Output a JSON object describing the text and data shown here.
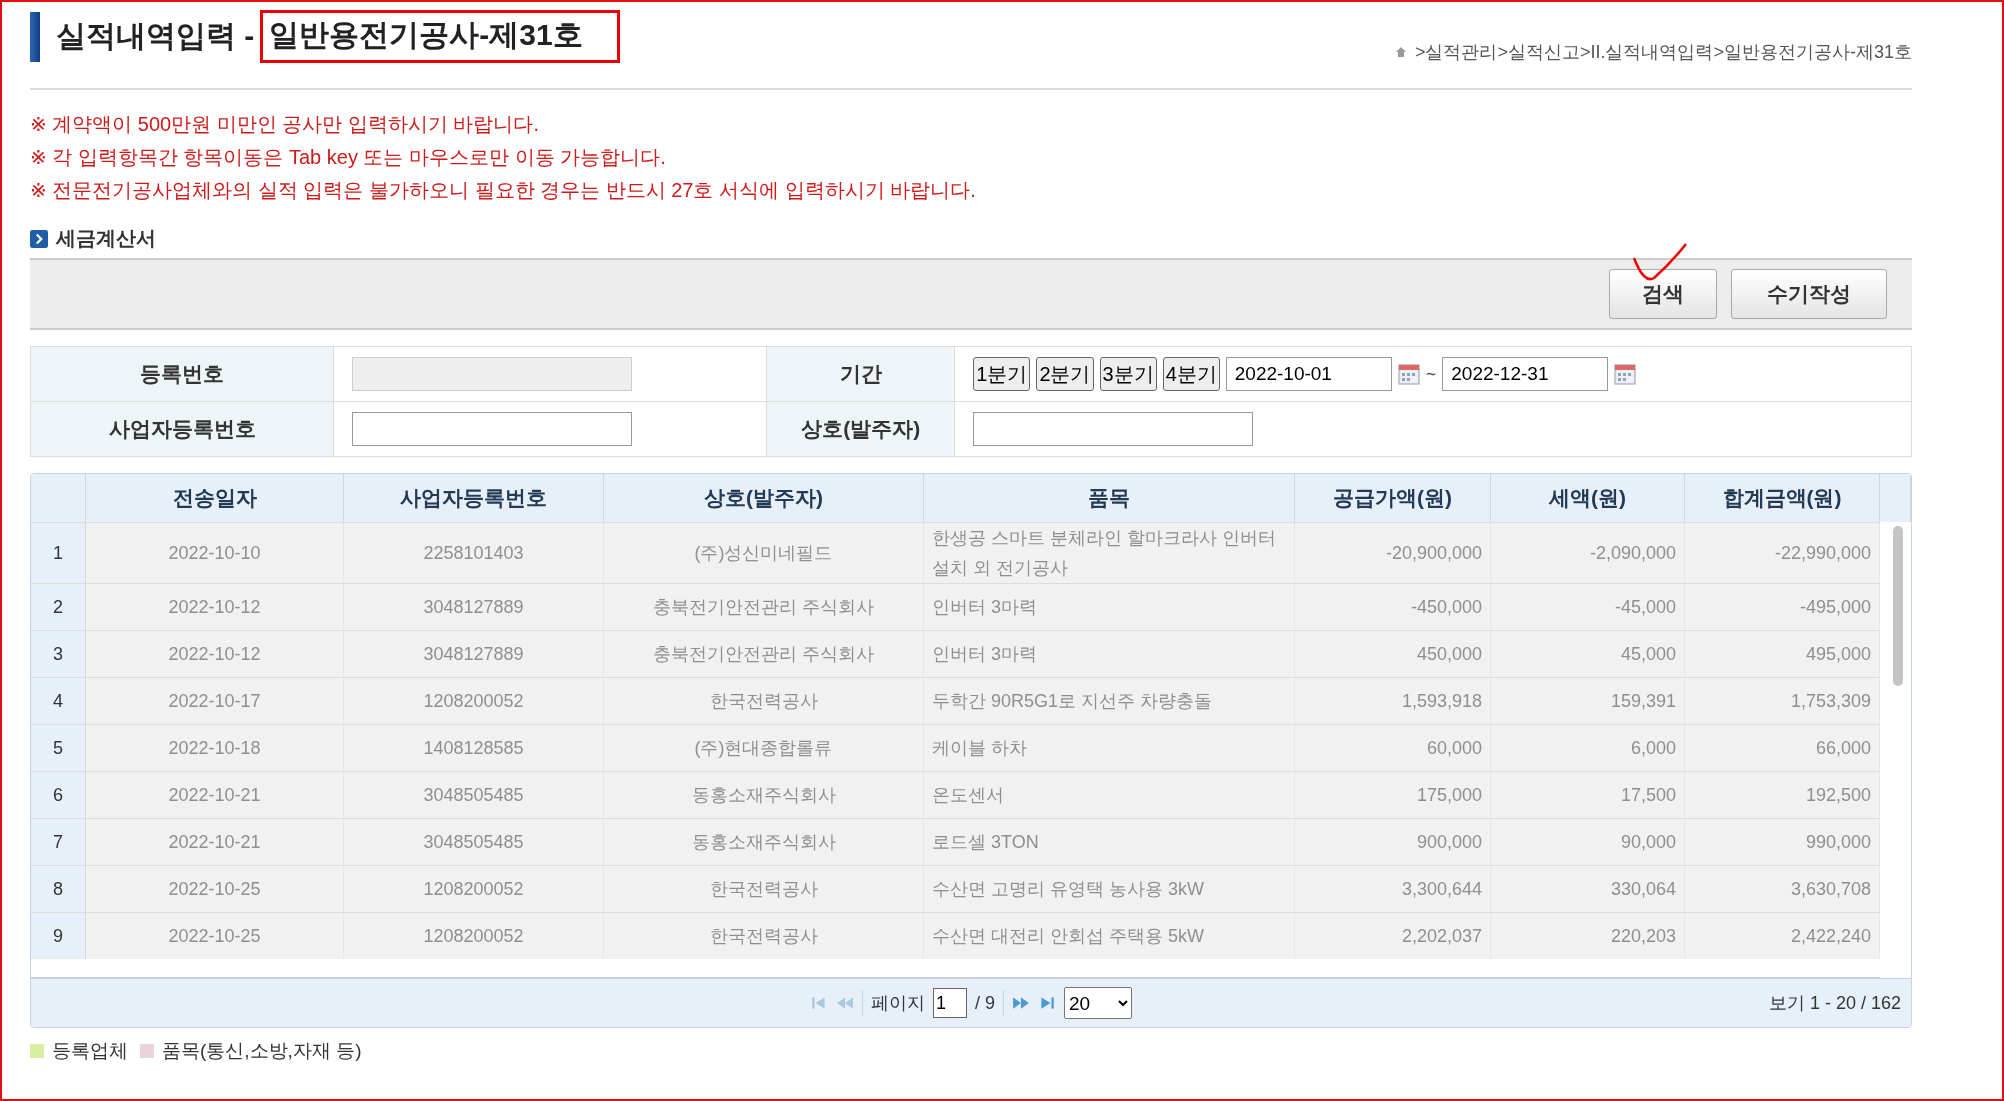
{
  "title": {
    "prefix": "실적내역입력 -",
    "highlight": "일반용전기공사-제31호"
  },
  "breadcrumb": ">실적관리>실적신고>II.실적내역입력>일반용전기공사-제31호",
  "notices": [
    "※ 계약액이 500만원 미만인 공사만 입력하시기 바랍니다.",
    "※ 각 입력항목간 항목이동은 Tab key 또는 마우스로만 이동 가능합니다.",
    "※ 전문전기공사업체와의 실적 입력은 불가하오니 필요한 경우는 반드시 27호 서식에 입력하시기 바랍니다."
  ],
  "section_title": "세금계산서",
  "toolbar_buttons": [
    "검색",
    "수기작성"
  ],
  "search_form": {
    "registration_number": {
      "label": "등록번호",
      "disabled": true
    },
    "business_number": {
      "label": "사업자등록번호",
      "disabled": false
    },
    "period": {
      "label": "기간",
      "quarters": [
        "1분기",
        "2분기",
        "3분기",
        "4분기"
      ],
      "start": "2022-10-01",
      "separator": "~",
      "end": "2022-12-31"
    },
    "company": {
      "label": "상호(발주자)"
    }
  },
  "grid": {
    "columns": [
      "전송일자",
      "사업자등록번호",
      "상호(발주자)",
      "품목",
      "공급가액(원)",
      "세액(원)",
      "합계금액(원)"
    ],
    "rows": [
      {
        "number": "1",
        "cells": [
          "2022-10-10",
          "2258101403",
          "(주)성신미네필드",
          "한생공 스마트 분체라인 할마크라사 인버터 설치 외 전기공사",
          "-20,900,000",
          "-2,090,000",
          "-22,990,000"
        ]
      },
      {
        "number": "2",
        "cells": [
          "2022-10-12",
          "3048127889",
          "충북전기안전관리 주식회사",
          "인버터 3마력",
          "-450,000",
          "-45,000",
          "-495,000"
        ]
      },
      {
        "number": "3",
        "cells": [
          "2022-10-12",
          "3048127889",
          "충북전기안전관리 주식회사",
          "인버터 3마력",
          "450,000",
          "45,000",
          "495,000"
        ]
      },
      {
        "number": "4",
        "cells": [
          "2022-10-17",
          "1208200052",
          "한국전력공사",
          "두학간 90R5G1로 지선주 차량충돌",
          "1,593,918",
          "159,391",
          "1,753,309"
        ]
      },
      {
        "number": "5",
        "cells": [
          "2022-10-18",
          "1408128585",
          "(주)현대종합롤류",
          "케이블 하차",
          "60,000",
          "6,000",
          "66,000"
        ]
      },
      {
        "number": "6",
        "cells": [
          "2022-10-21",
          "3048505485",
          "동홍소재주식회사",
          "온도센서",
          "175,000",
          "17,500",
          "192,500"
        ]
      },
      {
        "number": "7",
        "cells": [
          "2022-10-21",
          "3048505485",
          "동홍소재주식회사",
          "로드셀 3TON",
          "900,000",
          "90,000",
          "990,000"
        ]
      },
      {
        "number": "8",
        "cells": [
          "2022-10-25",
          "1208200052",
          "한국전력공사",
          "수산면 고명리 유영택 농사용 3kW",
          "3,300,644",
          "330,064",
          "3,630,708"
        ]
      },
      {
        "number": "9",
        "cells": [
          "2022-10-25",
          "1208200052",
          "한국전력공사",
          "수산면 대전리 안회섭 주택용 5kW",
          "2,202,037",
          "220,203",
          "2,422,240"
        ]
      }
    ],
    "pager": {
      "page_label": "페이지",
      "page": "1",
      "total": "/ 9",
      "page_size": "20",
      "summary": "보기 1 - 20 / 162"
    }
  },
  "legend": [
    {
      "label": "등록업체",
      "color": "#d8eea0"
    },
    {
      "label": "품목(통신,소방,자재 등)",
      "color": "#ead3da"
    }
  ]
}
